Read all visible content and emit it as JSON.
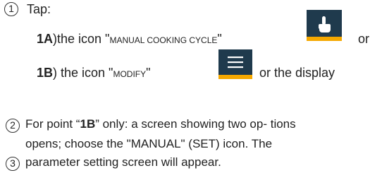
{
  "steps": {
    "s1": {
      "number": "1",
      "intro": "Tap:",
      "a": {
        "label": "1A",
        "paren": ")",
        "pre": "the icon \"",
        "name": "MANUAL COOKING CYCLE",
        "post": "\"",
        "or": "or"
      },
      "b": {
        "label": "1B",
        "paren": ")",
        "pre": " the icon \"",
        "name": "MODIFY",
        "post": "\"",
        "or_display": "or the display"
      }
    },
    "s2": {
      "number": "2",
      "line1_pre": "For point “",
      "line1_bold": "1B",
      "line1_post": "” only: a screen showing two op- tions",
      "line2": "opens; choose the \"MANUAL\" (SET) icon. The"
    },
    "s3": {
      "number": "3",
      "line": "parameter setting screen will appear."
    }
  },
  "icons": {
    "hand": "hand-pointer-icon",
    "menu": "hamburger-menu-icon"
  },
  "colors": {
    "icon_bg": "#1f3a4d",
    "icon_accent": "#f5a800"
  }
}
